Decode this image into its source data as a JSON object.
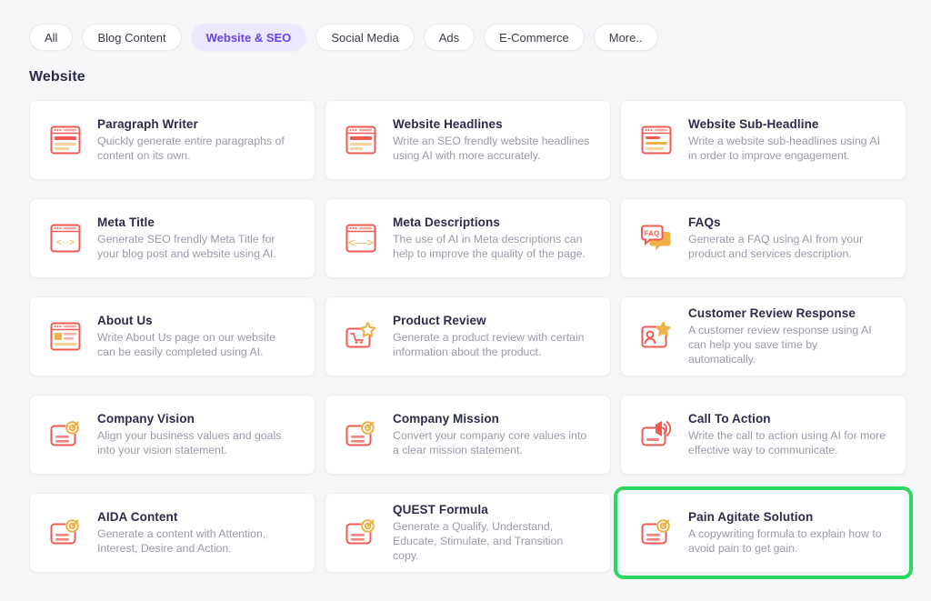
{
  "filters": {
    "chips": [
      {
        "label": "All",
        "active": false
      },
      {
        "label": "Blog Content",
        "active": false
      },
      {
        "label": "Website & SEO",
        "active": true
      },
      {
        "label": "Social Media",
        "active": false
      },
      {
        "label": "Ads",
        "active": false
      },
      {
        "label": "E-Commerce",
        "active": false
      },
      {
        "label": "More..",
        "active": false
      }
    ]
  },
  "section": {
    "title": "Website"
  },
  "colors": {
    "accent_purple": "#6c3ff0",
    "chip_active_bg": "#ece9fe",
    "icon_red": "#ef5b52",
    "icon_orange": "#efb045",
    "highlight_green": "#2ad862",
    "page_bg": "#f7f7f9",
    "card_bg": "#ffffff",
    "title_color": "#2b2b4b",
    "desc_color": "#9a9aa8"
  },
  "cards": [
    {
      "title": "Paragraph Writer",
      "desc": "Quickly generate entire paragraphs of content on its own.",
      "icon": "browser-paragraph-icon",
      "highlighted": false
    },
    {
      "title": "Website Headlines",
      "desc": "Write an SEO frendly website headlines using AI with more accurately.",
      "icon": "browser-headline-icon",
      "highlighted": false
    },
    {
      "title": "Website Sub-Headline",
      "desc": "Write a website sub-headlines using AI in order to improve engagement.",
      "icon": "browser-subheadline-icon",
      "highlighted": false
    },
    {
      "title": "Meta Title",
      "desc": "Generate SEO frendly Meta Title for your blog post and website using AI.",
      "icon": "browser-code-small-icon",
      "highlighted": false
    },
    {
      "title": "Meta Descriptions",
      "desc": "The use of AI in Meta descriptions can help to improve the quality of the page.",
      "icon": "browser-code-wide-icon",
      "highlighted": false
    },
    {
      "title": "FAQs",
      "desc": "Generate a FAQ using AI from your product and services description.",
      "icon": "faq-chat-bubble-icon",
      "highlighted": false
    },
    {
      "title": "About Us",
      "desc": "Write About Us page on our website can be easily completed using AI.",
      "icon": "browser-about-icon",
      "highlighted": false
    },
    {
      "title": "Product Review",
      "desc": "Generate a product review with certain information about the product.",
      "icon": "cart-star-icon",
      "highlighted": false
    },
    {
      "title": "Customer Review Response",
      "desc": "A customer review response using AI can help you save time by automatically.",
      "icon": "user-star-icon",
      "highlighted": false
    },
    {
      "title": "Company Vision",
      "desc": "Align your business values and goals into your vision statement.",
      "icon": "card-target-icon",
      "highlighted": false
    },
    {
      "title": "Company Mission",
      "desc": "Convert your company core values into a clear mission statement.",
      "icon": "card-target-icon",
      "highlighted": false
    },
    {
      "title": "Call To Action",
      "desc": "Write the call to action using AI for more effective way to communicate.",
      "icon": "card-megaphone-icon",
      "highlighted": false
    },
    {
      "title": "AIDA Content",
      "desc": "Generate a content with Attention, Interest, Desire and Action.",
      "icon": "card-target-icon",
      "highlighted": false
    },
    {
      "title": "QUEST Formula",
      "desc": "Generate a Qualify, Understand, Educate, Stimulate, and Transition copy.",
      "icon": "card-target-icon",
      "highlighted": false
    },
    {
      "title": "Pain Agitate Solution",
      "desc": "A copywriting formula to explain how to avoid pain to get gain.",
      "icon": "card-target-icon",
      "highlighted": true
    }
  ]
}
